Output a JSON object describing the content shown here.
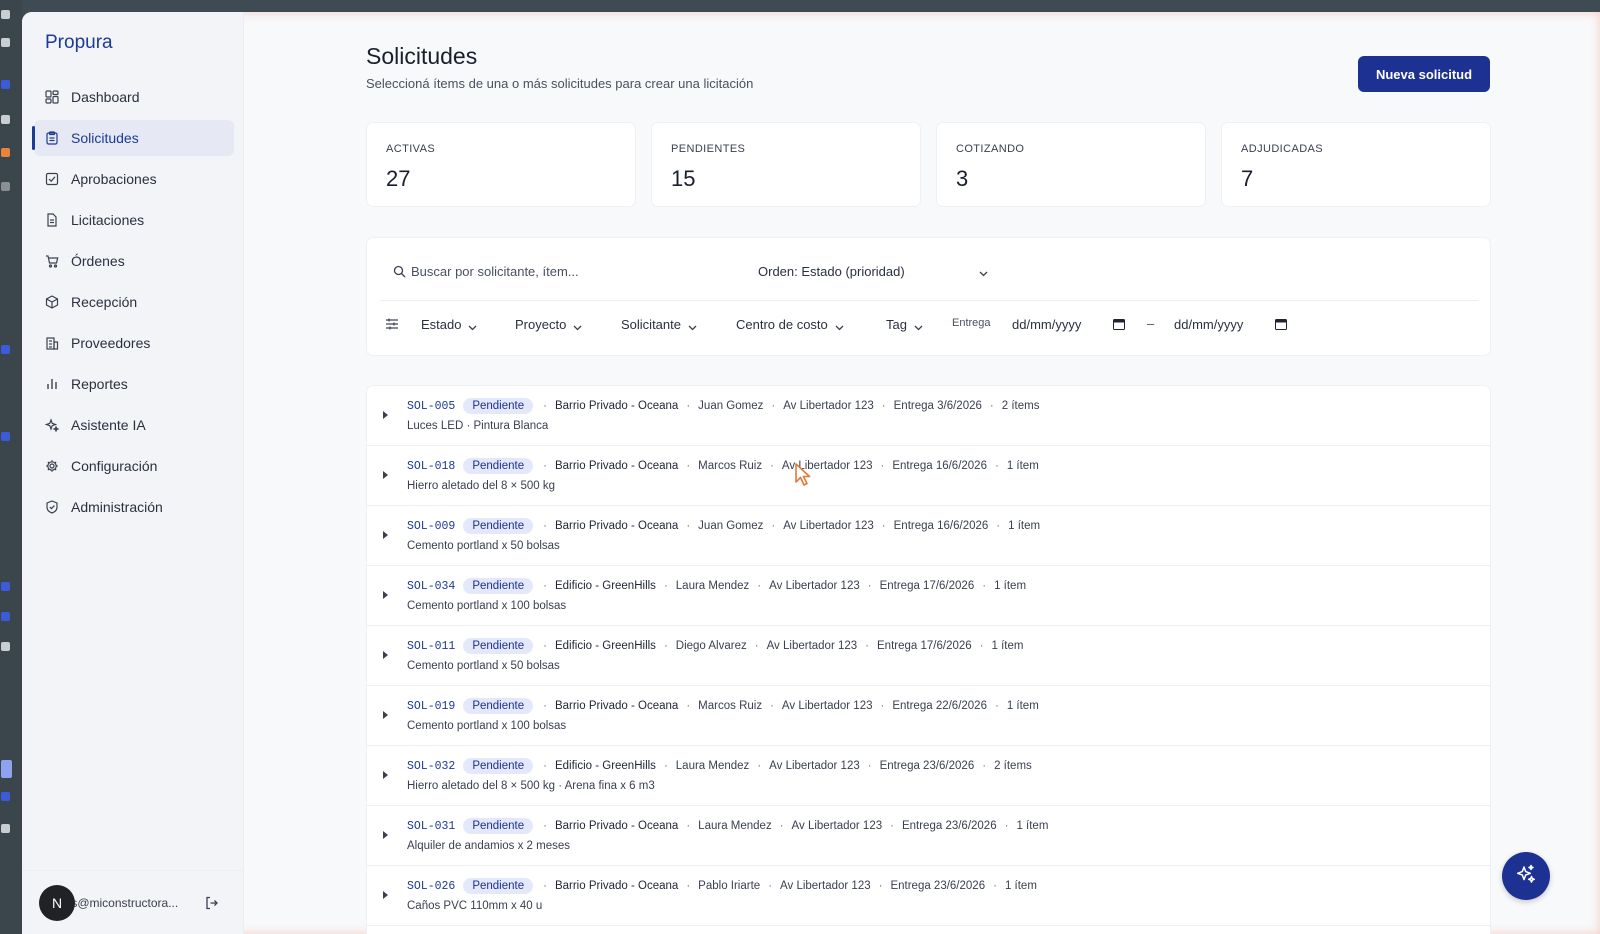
{
  "app": {
    "brand": "Propura"
  },
  "sidebar": {
    "items": [
      {
        "label": "Dashboard",
        "icon": "dashboard-icon"
      },
      {
        "label": "Solicitudes",
        "icon": "clipboard-icon",
        "active": true
      },
      {
        "label": "Aprobaciones",
        "icon": "check-square-icon"
      },
      {
        "label": "Licitaciones",
        "icon": "file-text-icon"
      },
      {
        "label": "Órdenes",
        "icon": "cart-icon"
      },
      {
        "label": "Recepción",
        "icon": "package-icon"
      },
      {
        "label": "Proveedores",
        "icon": "building-icon"
      },
      {
        "label": "Reportes",
        "icon": "bar-chart-icon"
      },
      {
        "label": "Asistente IA",
        "icon": "sparkles-icon"
      },
      {
        "label": "Configuración",
        "icon": "gear-icon"
      },
      {
        "label": "Administración",
        "icon": "shield-icon"
      }
    ],
    "user": {
      "initial": "N",
      "email": "c   s@miconstructora..."
    }
  },
  "header": {
    "title": "Solicitudes",
    "subtitle": "Seleccioná ítems de una o más solicitudes para crear una licitación",
    "new_button": "Nueva solicitud"
  },
  "stats": [
    {
      "label": "ACTIVAS",
      "value": "27"
    },
    {
      "label": "PENDIENTES",
      "value": "15"
    },
    {
      "label": "COTIZANDO",
      "value": "3"
    },
    {
      "label": "ADJUDICADAS",
      "value": "7"
    }
  ],
  "filters": {
    "search_placeholder": "Buscar por solicitante, ítem...",
    "order_label": "Orden: Estado (prioridad)",
    "dropdowns": [
      "Estado",
      "Proyecto",
      "Solicitante",
      "Centro de costo",
      "Tag"
    ],
    "entrega_label": "Entrega",
    "date_from": "dd/mm/yyyy",
    "date_dash": "–",
    "date_to": "dd/mm/yyyy"
  },
  "requests": [
    {
      "id": "SOL-005",
      "status": "Pendiente",
      "project": "Barrio Privado - Oceana",
      "requester": "Juan Gomez",
      "address": "Av Libertador 123",
      "delivery": "Entrega 3/6/2026",
      "count": "2 ítems",
      "items": "Luces LED · Pintura Blanca"
    },
    {
      "id": "SOL-018",
      "status": "Pendiente",
      "project": "Barrio Privado - Oceana",
      "requester": "Marcos Ruiz",
      "address": "Av Libertador 123",
      "delivery": "Entrega 16/6/2026",
      "count": "1 ítem",
      "items": "Hierro aletado del 8 × 500 kg"
    },
    {
      "id": "SOL-009",
      "status": "Pendiente",
      "project": "Barrio Privado - Oceana",
      "requester": "Juan Gomez",
      "address": "Av Libertador 123",
      "delivery": "Entrega 16/6/2026",
      "count": "1 ítem",
      "items": "Cemento portland x 50 bolsas"
    },
    {
      "id": "SOL-034",
      "status": "Pendiente",
      "project": "Edificio - GreenHills",
      "requester": "Laura Mendez",
      "address": "Av Libertador 123",
      "delivery": "Entrega 17/6/2026",
      "count": "1 ítem",
      "items": "Cemento portland x 100 bolsas"
    },
    {
      "id": "SOL-011",
      "status": "Pendiente",
      "project": "Edificio - GreenHills",
      "requester": "Diego Alvarez",
      "address": "Av Libertador 123",
      "delivery": "Entrega 17/6/2026",
      "count": "1 ítem",
      "items": "Cemento portland x 50 bolsas"
    },
    {
      "id": "SOL-019",
      "status": "Pendiente",
      "project": "Barrio Privado - Oceana",
      "requester": "Marcos Ruiz",
      "address": "Av Libertador 123",
      "delivery": "Entrega 22/6/2026",
      "count": "1 ítem",
      "items": "Cemento portland x 100 bolsas"
    },
    {
      "id": "SOL-032",
      "status": "Pendiente",
      "project": "Edificio - GreenHills",
      "requester": "Laura Mendez",
      "address": "Av Libertador 123",
      "delivery": "Entrega 23/6/2026",
      "count": "2 ítems",
      "items": "Hierro aletado del 8 × 500 kg · Arena fina x 6 m3"
    },
    {
      "id": "SOL-031",
      "status": "Pendiente",
      "project": "Barrio Privado - Oceana",
      "requester": "Laura Mendez",
      "address": "Av Libertador 123",
      "delivery": "Entrega 23/6/2026",
      "count": "1 ítem",
      "items": "Alquiler de andamios x 2 meses"
    },
    {
      "id": "SOL-026",
      "status": "Pendiente",
      "project": "Barrio Privado - Oceana",
      "requester": "Pablo Iriarte",
      "address": "Av Libertador 123",
      "delivery": "Entrega 23/6/2026",
      "count": "1 ítem",
      "items": "Caños PVC 110mm x 40 u"
    }
  ]
}
